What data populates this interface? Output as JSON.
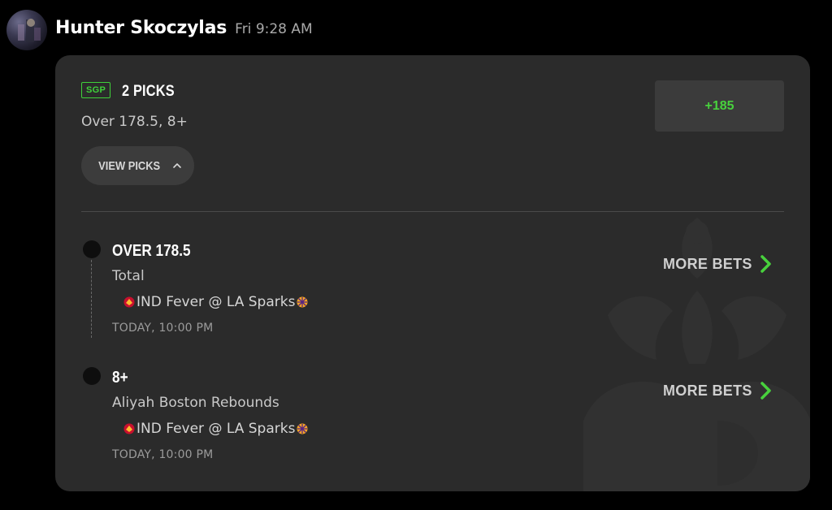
{
  "message": {
    "author": "Hunter Skoczylas",
    "timestamp": "Fri 9:28 AM"
  },
  "bet": {
    "badge": "SGP",
    "picks_count": "2 PICKS",
    "summary": "Over 178.5, 8+",
    "view_picks_label": "VIEW PICKS",
    "odds": "+185",
    "picks": [
      {
        "title": "OVER 178.5",
        "market": "Total",
        "game": "IND Fever @ LA Sparks",
        "time": "TODAY, 10:00 PM",
        "more_bets_label": "MORE BETS"
      },
      {
        "title": "8+",
        "market": "Aliyah Boston Rebounds",
        "game": "IND Fever @ LA Sparks",
        "time": "TODAY, 10:00 PM",
        "more_bets_label": "MORE BETS"
      }
    ]
  },
  "colors": {
    "accent_green": "#48d13d",
    "card_background": "#2b2b2b",
    "page_background": "#000000"
  },
  "icons": [
    "avatar",
    "chevron-up-icon",
    "chevron-right-icon",
    "fever-team-logo",
    "sparks-team-logo",
    "draftkings-watermark"
  ]
}
